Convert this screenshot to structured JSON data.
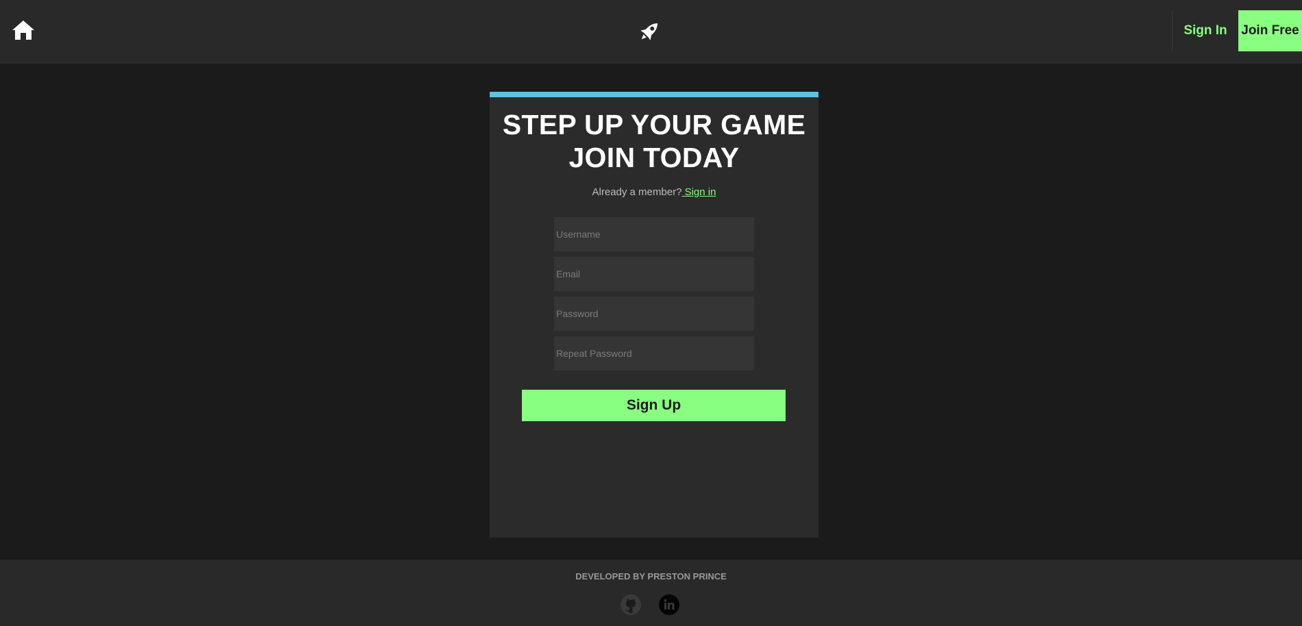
{
  "nav": {
    "home_icon": "home-icon",
    "logo_icon": "rocket-icon",
    "signin_label": "Sign In",
    "join_label": "Join Free"
  },
  "signup": {
    "headline_line1": "STEP UP YOUR GAME",
    "headline_line2": "JOIN TODAY",
    "member_text": "Already a member?",
    "signin_link": " Sign in",
    "username_placeholder": "Username",
    "email_placeholder": "Email",
    "password_placeholder": "Password",
    "repeat_password_placeholder": "Repeat Password",
    "submit_label": "Sign Up"
  },
  "footer": {
    "credit": "DEVELOPED BY PRESTON PRINCE",
    "github_icon": "github-icon",
    "linkedin_icon": "linkedin-icon"
  },
  "colors": {
    "accent_green": "#88ff80",
    "accent_blue": "#5ec3e6",
    "background": "#1b1b1b",
    "panel": "#292929"
  }
}
